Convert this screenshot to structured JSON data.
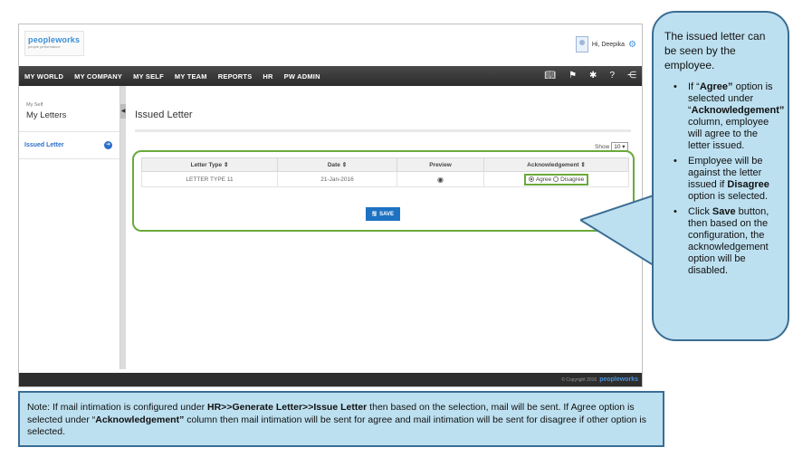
{
  "app": {
    "logo": {
      "main": "peopleworks",
      "sub": "people performance"
    },
    "user": {
      "greeting": "Hi, Deepika"
    },
    "nav": [
      "MY WORLD",
      "MY COMPANY",
      "MY SELF",
      "MY TEAM",
      "REPORTS",
      "HR",
      "PW ADMIN"
    ],
    "nav_icons": [
      "book-icon",
      "flag-icon",
      "tools-icon",
      "help-icon",
      "share-icon"
    ],
    "sidebar": {
      "breadcrumb_small": "My Self",
      "breadcrumb_large": "My Letters",
      "item": "Issued Letter"
    },
    "main": {
      "title": "Issued Letter",
      "show_label": "Show",
      "show_value": "10",
      "table": {
        "headers": [
          "Letter Type ⇕",
          "Date ⇕",
          "Preview",
          "Acknowledgement ⇕"
        ],
        "rows": [
          {
            "letter_type": "LETTER TYPE 11",
            "date": "21-Jan-2016",
            "ack_agree": "Agree",
            "ack_disagree": "Disagree",
            "selected": "Agree"
          }
        ]
      },
      "save_label": "SAVE"
    },
    "footer": {
      "copyright": "© Copyright 2016",
      "logo": "peopleworks"
    }
  },
  "callout": {
    "intro": "The issued letter can be seen by the employee.",
    "bullets": [
      {
        "pre": "If “",
        "bold1": "Agree”",
        "mid": " option is selected under “",
        "bold2": "Acknowledgement”",
        "post": " column, employee will agree to the letter issued."
      },
      {
        "pre": "Employee will be against the letter issued if ",
        "bold1": "Disagree",
        "mid": " option is selected.",
        "bold2": "",
        "post": ""
      },
      {
        "pre": "Click ",
        "bold1": "Save",
        "mid": " button, then based on the configuration, the acknowledgement option will be disabled.",
        "bold2": "",
        "post": ""
      }
    ]
  },
  "note": {
    "p1": "Note: If mail intimation is configured under ",
    "b1": "HR>>Generate Letter>>Issue Letter",
    "p2": " then based on the selection, mail will be sent. If Agree option is selected under “",
    "b2": "Acknowledgement”",
    "p3": " column then mail intimation will be sent for agree and mail intimation will be sent for disagree if other option is selected."
  },
  "colors": {
    "nav_bg": "#333333",
    "link_blue": "#2a70c8",
    "highlight_green": "#6aaa3a",
    "callout_fill": "#bde0f0",
    "callout_border": "#3a6d94",
    "save_button": "#1e72c2"
  }
}
